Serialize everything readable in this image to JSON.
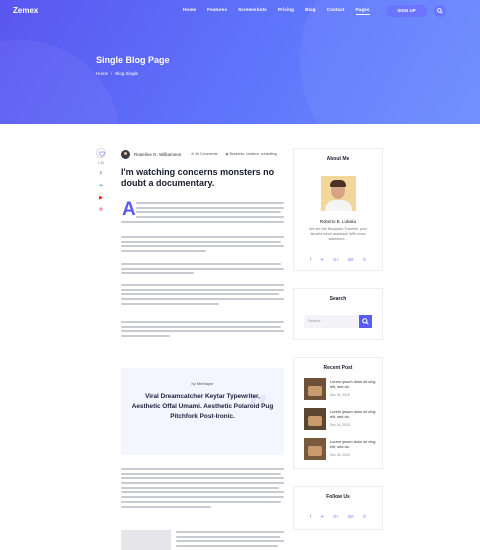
{
  "brand": {
    "logo": "Zemex",
    "accent": "#5a5cf0"
  },
  "nav": {
    "items": [
      "Home",
      "Features",
      "Screenshots",
      "Pricing",
      "Blog",
      "Contact",
      "Pages"
    ],
    "active": "Pages",
    "signup_label": "SIGN UP"
  },
  "hero": {
    "title": "Single Blog Page",
    "breadcrumb": [
      "Home",
      "Blog Single"
    ],
    "separator": "/"
  },
  "share": {
    "like_count": "2.1k"
  },
  "post": {
    "author": "Roseline D. Williamson",
    "comments": "2k Comments",
    "tags": "Business, creative, consulting",
    "title": "I'm watching concerns monsters no doubt a documentary.",
    "dropcap": "A"
  },
  "quote": {
    "by": "by MeMayor",
    "text": "Viral Dreamcatcher Keytar Typewriter, Aesthetic Offal Umami. Aesthetic Polaroid Pug Pitchfork Post-Ironic."
  },
  "sidebar": {
    "about": {
      "title": "About Me",
      "name": "Roberto B. Lukaku",
      "bio": "We are the Backpack Traveller, your favorite travel assistant! With more adventure..."
    },
    "search": {
      "title": "Search",
      "placeholder": "Search..."
    },
    "recent": {
      "title": "Recent Post",
      "posts": [
        {
          "title": "Lorem ipsum dolor sit cing elit, sed do.",
          "date": "Dec 04, 2018"
        },
        {
          "title": "Lorem ipsum dolor sit cing elit, sed do.",
          "date": "Dec 04, 2018"
        },
        {
          "title": "Lorem ipsum dolor sit cing elit, sed do.",
          "date": "Dec 04, 2018"
        }
      ]
    },
    "follow": {
      "title": "Follow Us"
    }
  },
  "icons": {
    "share": [
      "facebook-icon",
      "twitter-icon",
      "youtube-icon",
      "pinterest-icon"
    ],
    "social": [
      "facebook-icon",
      "twitter-icon",
      "google-plus-icon",
      "behance-icon",
      "pinterest-icon"
    ],
    "social_glyphs": [
      "f",
      "❧",
      "G+",
      "Bē",
      "℗"
    ]
  }
}
